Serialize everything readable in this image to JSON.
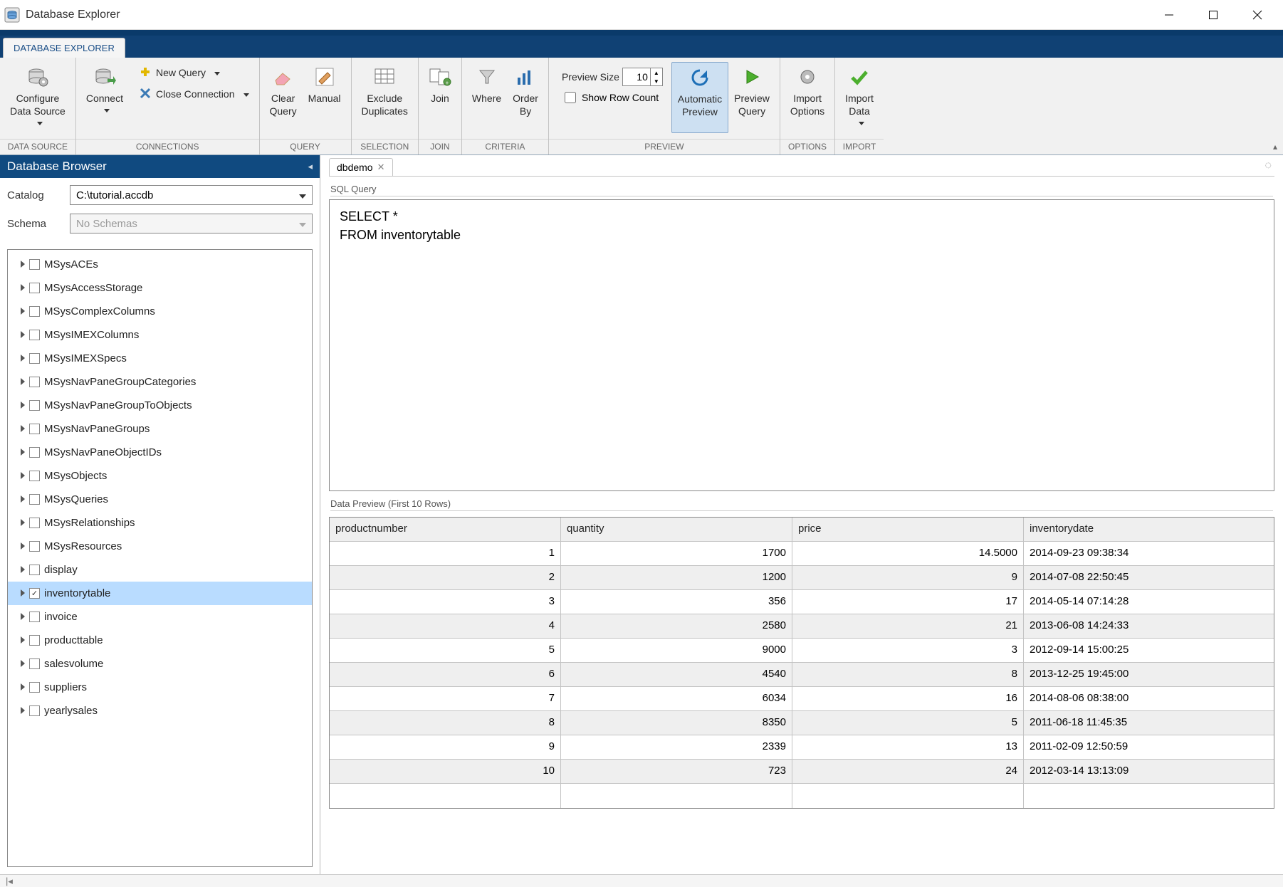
{
  "window": {
    "title": "Database Explorer"
  },
  "ribbon": {
    "tab": "DATABASE EXPLORER",
    "groups": {
      "dataSource": {
        "label": "DATA SOURCE",
        "configure": "Configure\nData Source"
      },
      "connections": {
        "label": "CONNECTIONS",
        "connect": "Connect",
        "newQuery": "New Query",
        "closeConn": "Close Connection"
      },
      "query": {
        "label": "QUERY",
        "clear": "Clear\nQuery",
        "manual": "Manual"
      },
      "selection": {
        "label": "SELECTION",
        "exclude": "Exclude\nDuplicates"
      },
      "join": {
        "label": "JOIN",
        "join": "Join"
      },
      "criteria": {
        "label": "CRITERIA",
        "where": "Where",
        "orderBy": "Order\nBy"
      },
      "preview": {
        "label": "PREVIEW",
        "sizeLabel": "Preview Size",
        "sizeValue": "10",
        "showRowCount": "Show Row Count",
        "auto": "Automatic\nPreview",
        "run": "Preview\nQuery"
      },
      "options": {
        "label": "OPTIONS",
        "importOpt": "Import\nOptions"
      },
      "import": {
        "label": "IMPORT",
        "importData": "Import\nData"
      }
    }
  },
  "sidebar": {
    "title": "Database Browser",
    "catalogLabel": "Catalog",
    "catalogValue": "C:\\tutorial.accdb",
    "schemaLabel": "Schema",
    "schemaPlaceholder": "No Schemas",
    "tables": [
      {
        "name": "MSysACEs",
        "checked": false,
        "selected": false
      },
      {
        "name": "MSysAccessStorage",
        "checked": false,
        "selected": false
      },
      {
        "name": "MSysComplexColumns",
        "checked": false,
        "selected": false
      },
      {
        "name": "MSysIMEXColumns",
        "checked": false,
        "selected": false
      },
      {
        "name": "MSysIMEXSpecs",
        "checked": false,
        "selected": false
      },
      {
        "name": "MSysNavPaneGroupCategories",
        "checked": false,
        "selected": false
      },
      {
        "name": "MSysNavPaneGroupToObjects",
        "checked": false,
        "selected": false
      },
      {
        "name": "MSysNavPaneGroups",
        "checked": false,
        "selected": false
      },
      {
        "name": "MSysNavPaneObjectIDs",
        "checked": false,
        "selected": false
      },
      {
        "name": "MSysObjects",
        "checked": false,
        "selected": false
      },
      {
        "name": "MSysQueries",
        "checked": false,
        "selected": false
      },
      {
        "name": "MSysRelationships",
        "checked": false,
        "selected": false
      },
      {
        "name": "MSysResources",
        "checked": false,
        "selected": false
      },
      {
        "name": "display",
        "checked": false,
        "selected": false
      },
      {
        "name": "inventorytable",
        "checked": true,
        "selected": true
      },
      {
        "name": "invoice",
        "checked": false,
        "selected": false
      },
      {
        "name": "producttable",
        "checked": false,
        "selected": false
      },
      {
        "name": "salesvolume",
        "checked": false,
        "selected": false
      },
      {
        "name": "suppliers",
        "checked": false,
        "selected": false
      },
      {
        "name": "yearlysales",
        "checked": false,
        "selected": false
      }
    ]
  },
  "main": {
    "tab": "dbdemo",
    "sqlLabel": "SQL Query",
    "sql": "SELECT *\nFROM inventorytable",
    "previewLabel": "Data Preview (First 10 Rows)",
    "columns": [
      "productnumber",
      "quantity",
      "price",
      "inventorydate"
    ],
    "rows": [
      {
        "productnumber": "1",
        "quantity": "1700",
        "price": "14.5000",
        "inventorydate": "2014-09-23 09:38:34"
      },
      {
        "productnumber": "2",
        "quantity": "1200",
        "price": "9",
        "inventorydate": "2014-07-08 22:50:45"
      },
      {
        "productnumber": "3",
        "quantity": "356",
        "price": "17",
        "inventorydate": "2014-05-14 07:14:28"
      },
      {
        "productnumber": "4",
        "quantity": "2580",
        "price": "21",
        "inventorydate": "2013-06-08 14:24:33"
      },
      {
        "productnumber": "5",
        "quantity": "9000",
        "price": "3",
        "inventorydate": "2012-09-14 15:00:25"
      },
      {
        "productnumber": "6",
        "quantity": "4540",
        "price": "8",
        "inventorydate": "2013-12-25 19:45:00"
      },
      {
        "productnumber": "7",
        "quantity": "6034",
        "price": "16",
        "inventorydate": "2014-08-06 08:38:00"
      },
      {
        "productnumber": "8",
        "quantity": "8350",
        "price": "5",
        "inventorydate": "2011-06-18 11:45:35"
      },
      {
        "productnumber": "9",
        "quantity": "2339",
        "price": "13",
        "inventorydate": "2011-02-09 12:50:59"
      },
      {
        "productnumber": "10",
        "quantity": "723",
        "price": "24",
        "inventorydate": "2012-03-14 13:13:09"
      }
    ]
  },
  "footer": {
    "nav": "|◂"
  }
}
